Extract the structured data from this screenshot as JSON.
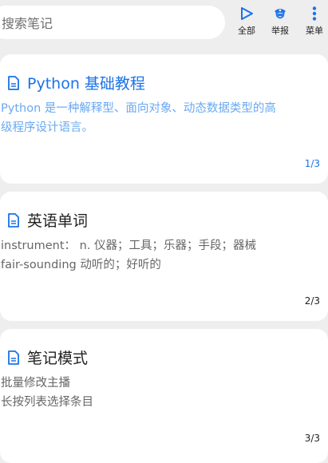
{
  "search": {
    "placeholder": "搜索笔记"
  },
  "actions": [
    {
      "label": "全部",
      "icon": "play-triangle-icon"
    },
    {
      "label": "举报",
      "icon": "police-officer-icon"
    },
    {
      "label": "菜单",
      "icon": "more-vertical-icon"
    }
  ],
  "colors": {
    "accent": "#1a73e8",
    "accent_light": "#6aa9f0",
    "text": "#222222",
    "muted": "#666666",
    "background": "#eeeeee",
    "card": "#ffffff"
  },
  "notes": [
    {
      "title": "Python 基础教程",
      "lines": [
        "Python 是一种解释型、面向对象、动态数据类型的高",
        "级程序设计语言。"
      ],
      "count": "1/3",
      "icon": "document-icon"
    },
    {
      "title": "英语单词",
      "lines": [
        "instrument： n. 仪器；工具；乐器；手段；器械",
        "fair-sounding 动听的；好听的"
      ],
      "count": "2/3",
      "icon": "document-icon"
    },
    {
      "title": "笔记模式",
      "lines": [
        "批量修改主播",
        "长按列表选择条目"
      ],
      "count": "3/3",
      "icon": "document-icon"
    }
  ]
}
